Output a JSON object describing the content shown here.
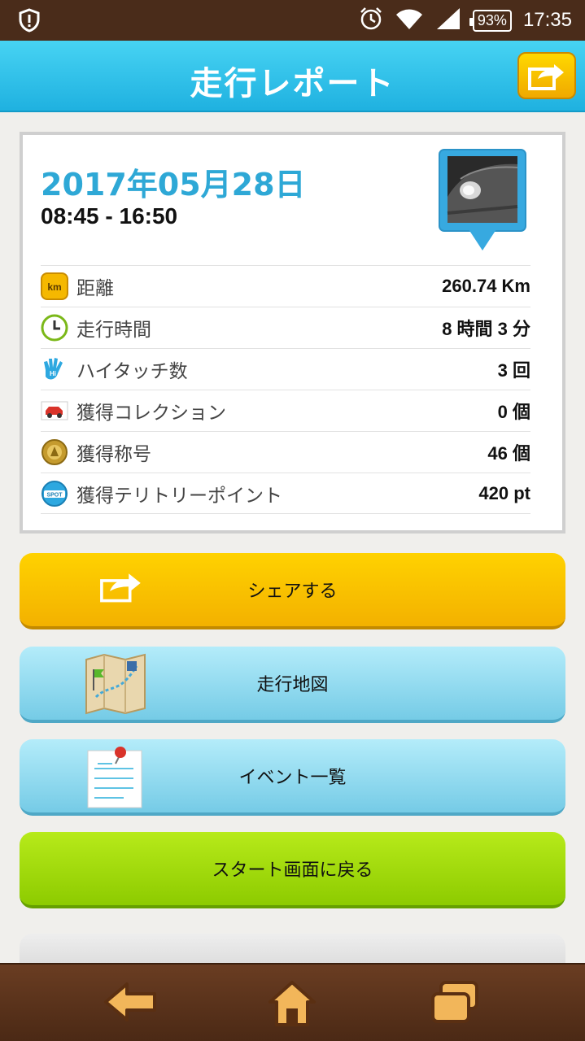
{
  "status_bar": {
    "left_icon": "shield-alert-icon",
    "icons": [
      "alarm-clock-icon",
      "wifi-icon",
      "cell-signal-icon"
    ],
    "battery": "93%",
    "time": "17:35"
  },
  "header": {
    "title": "走行レポート",
    "share_icon": "share-arrow-icon"
  },
  "report": {
    "date": "2017年05月28日",
    "time_range": "08:45 - 16:50",
    "photo_icon": "car-photo-pin-icon",
    "rows": [
      {
        "icon": "km-icon",
        "label": "距離",
        "value": "260.74 Km"
      },
      {
        "icon": "clock-icon",
        "label": "走行時間",
        "value": "8 時間 3 分"
      },
      {
        "icon": "hightouch-hand-icon",
        "label": "ハイタッチ数",
        "value": "3 回"
      },
      {
        "icon": "car-icon",
        "label": "獲得コレクション",
        "value": "0 個"
      },
      {
        "icon": "medal-icon",
        "label": "獲得称号",
        "value": "46 個"
      },
      {
        "icon": "spot-icon",
        "label": "獲得テリトリーポイント",
        "value": "420 pt"
      }
    ]
  },
  "buttons": {
    "share": "シェアする",
    "map": "走行地図",
    "events": "イベント一覧",
    "back_to_start": "スタート画面に戻る"
  },
  "bottom_nav": [
    "back-arrow-icon",
    "home-icon",
    "windows-icon"
  ],
  "colors": {
    "header": "#2bbde8",
    "accent_date": "#2ea8d6",
    "share_button": "#ffcc00",
    "blue_button": "#9adff3",
    "green_button": "#9fd80a",
    "wood": "#5a331c"
  }
}
